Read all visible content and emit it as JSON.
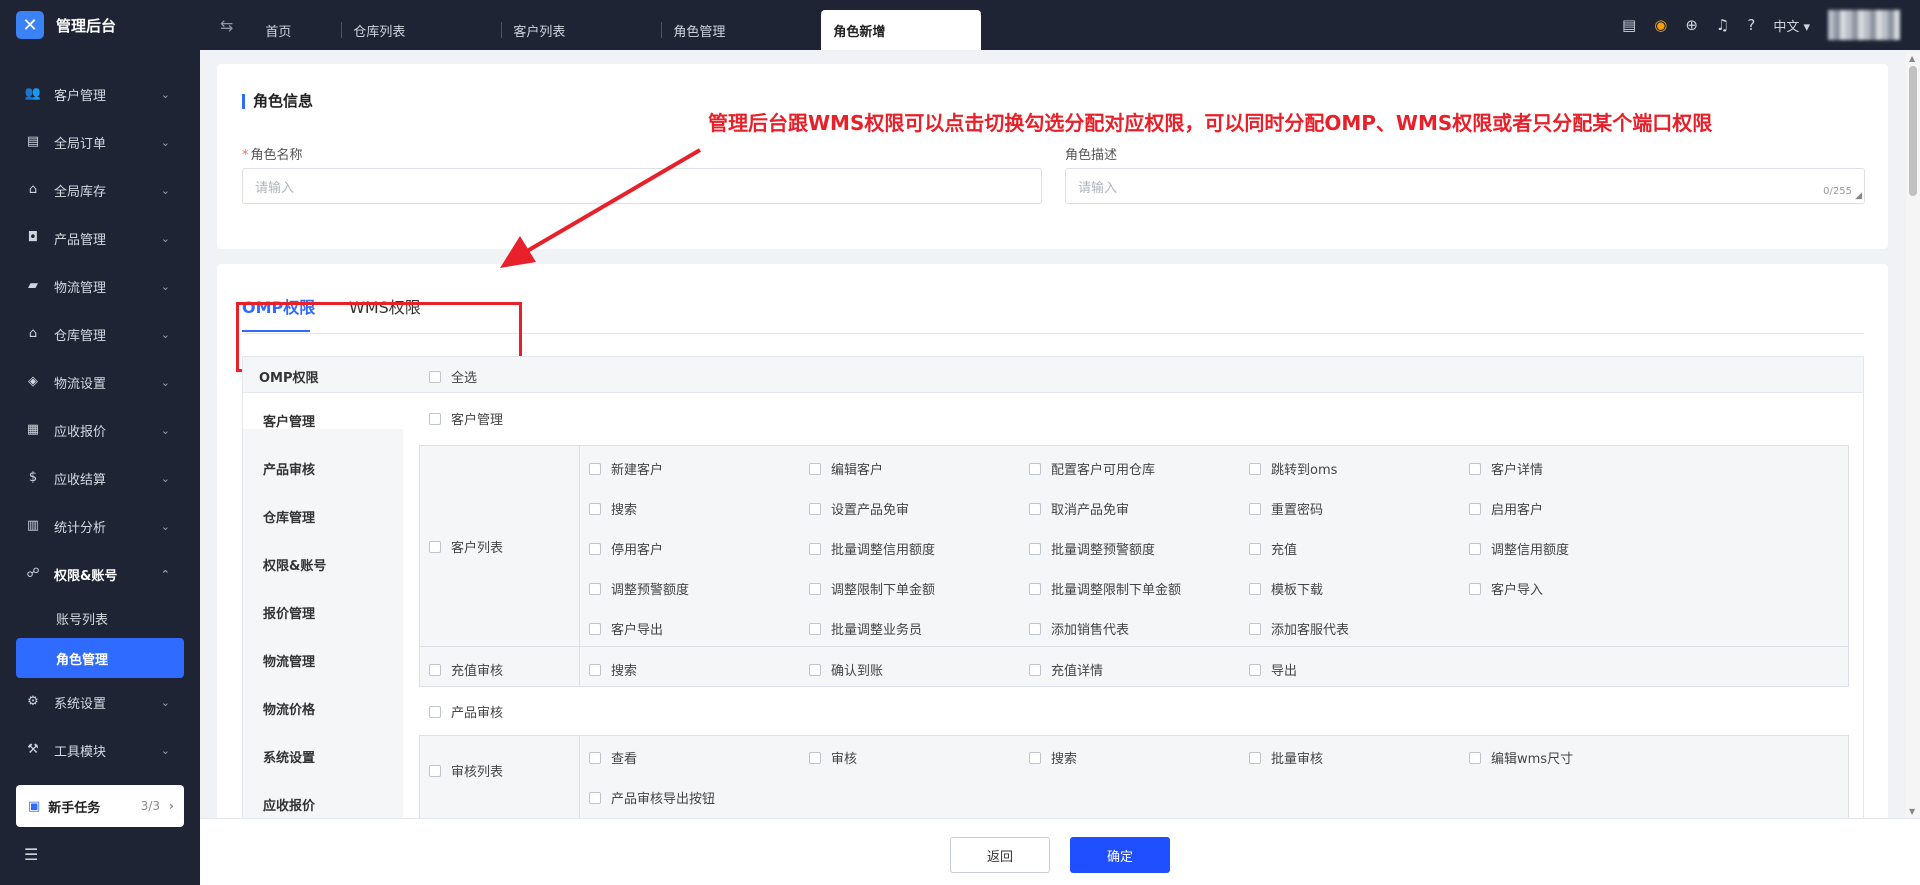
{
  "app": {
    "title": "管理后台"
  },
  "tabs": [
    {
      "label": "首页"
    },
    {
      "label": "仓库列表"
    },
    {
      "label": "客户列表"
    },
    {
      "label": "角色管理"
    },
    {
      "label": "角色新增"
    }
  ],
  "header": {
    "lang": "中文"
  },
  "sidebar": {
    "items": [
      {
        "label": "客户管理",
        "icon": "users-icon"
      },
      {
        "label": "全局订单",
        "icon": "clipboard-icon"
      },
      {
        "label": "全局库存",
        "icon": "bank-icon"
      },
      {
        "label": "产品管理",
        "icon": "bag-icon"
      },
      {
        "label": "物流管理",
        "icon": "truck-icon"
      },
      {
        "label": "仓库管理",
        "icon": "warehouse-icon"
      },
      {
        "label": "物流设置",
        "icon": "box-icon"
      },
      {
        "label": "应收报价",
        "icon": "document-icon"
      },
      {
        "label": "应收结算",
        "icon": "dollar-icon"
      },
      {
        "label": "统计分析",
        "icon": "chart-icon"
      },
      {
        "label": "权限&账号",
        "icon": "network-icon"
      }
    ],
    "sub_items": [
      {
        "label": "账号列表"
      },
      {
        "label": "角色管理"
      }
    ],
    "items_after": [
      {
        "label": "系统设置",
        "icon": "gear-icon"
      },
      {
        "label": "工具模块",
        "icon": "wrench-icon"
      }
    ],
    "new_task": {
      "label": "新手任务",
      "count": "3/3"
    }
  },
  "role_info": {
    "title": "角色信息",
    "name_label": "角色名称",
    "name_placeholder": "请输入",
    "desc_label": "角色描述",
    "desc_placeholder": "请输入",
    "desc_counter": "0/255"
  },
  "annotation": "管理后台跟WMS权限可以点击切换勾选分配对应权限，可以同时分配OMP、WMS权限或者只分配某个端口权限",
  "perm_tabs": [
    {
      "label": "OMP权限"
    },
    {
      "label": "WMS权限"
    }
  ],
  "perm": {
    "header_label": "OMP权限",
    "select_all": "全选",
    "side": [
      "客户管理",
      "产品审核",
      "仓库管理",
      "权限&账号",
      "报价管理",
      "物流管理",
      "物流价格",
      "系统设置",
      "应收报价"
    ],
    "group1": "客户管理",
    "customer_list": {
      "label": "客户列表",
      "rows": [
        [
          "新建客户",
          "编辑客户",
          "配置客户可用仓库",
          "跳转到oms",
          "客户详情"
        ],
        [
          "搜索",
          "设置产品免审",
          "取消产品免审",
          "重置密码",
          "启用客户"
        ],
        [
          "停用客户",
          "批量调整信用额度",
          "批量调整预警额度",
          "充值",
          "调整信用额度"
        ],
        [
          "调整预警额度",
          "调整限制下单金额",
          "批量调整限制下单金额",
          "模板下载",
          "客户导入"
        ],
        [
          "客户导出",
          "批量调整业务员",
          "添加销售代表",
          "添加客服代表"
        ]
      ]
    },
    "recharge_audit": {
      "label": "充值审核",
      "items": [
        "搜索",
        "确认到账",
        "充值详情",
        "导出"
      ]
    },
    "group2": "产品审核",
    "audit_list": {
      "label": "审核列表",
      "rows": [
        [
          "查看",
          "审核",
          "搜索",
          "批量审核",
          "编辑wms尺寸"
        ],
        [
          "产品审核导出按钮"
        ]
      ]
    }
  },
  "footer": {
    "back": "返回",
    "confirm": "确定"
  }
}
